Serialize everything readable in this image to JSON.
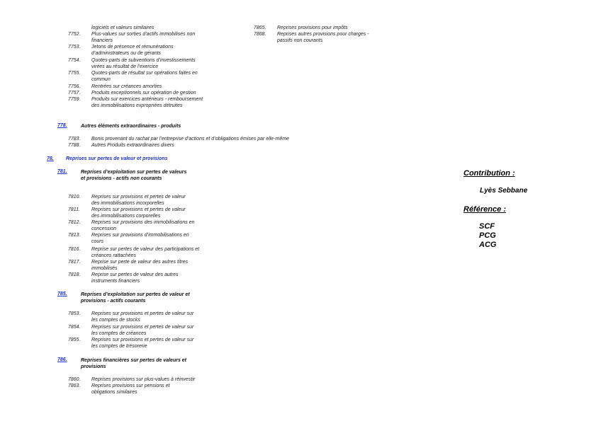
{
  "left_top_items": [
    {
      "code": "",
      "text": "logiciels et valeurs similaires"
    },
    {
      "code": "7752.",
      "text": "Plus-values sur sorties d’actifs immobilisés non financiers"
    },
    {
      "code": "7753.",
      "text": "Jetons de présence et rémunérations d’administrateurs ou de gérants"
    },
    {
      "code": "7754.",
      "text": "Quotes-parts de subventions d’investissements virées au résultat de l’exercice"
    },
    {
      "code": "7755.",
      "text": "Quotes-parts de résultat sur opérations faites en commun"
    },
    {
      "code": "7756.",
      "text": "Rentrées sur créances amorties"
    },
    {
      "code": "7757.",
      "text": "Produits exceptionnels sur opération de gestion"
    },
    {
      "code": "7759.",
      "text": "Produits sur exercices antérieurs - remboursement des immobilisations expropriées détruites"
    }
  ],
  "right_top_items": [
    {
      "code": "7865.",
      "text": "Reprises provisions pour impôts"
    },
    {
      "code": "7868.",
      "text": "Reprises autres provisions pour charges - passifs non courants"
    }
  ],
  "s778": {
    "code": "778.",
    "title": "Autres éléments extraordinaires - produits"
  },
  "s778_items": [
    {
      "code": "7783.",
      "text": "Bonis provenant du rachat par l’entreprise d’actions et d’obligations émises par elle-même"
    },
    {
      "code": "7788.",
      "text": "Autres Produits extraordinaires divers"
    }
  ],
  "s78": {
    "code": "78.",
    "title": "Reprises sur pertes de valeur et provisions"
  },
  "s781": {
    "code": "781.",
    "title": "Reprises d’exploitation sur pertes de valeurs et provisions - actifs non courants"
  },
  "s781_items": [
    {
      "code": "7810.",
      "text": "Reprises sur provisions et pertes de valeur des immobilisations incorporelles"
    },
    {
      "code": "7811.",
      "text": "Reprises sur provisions et pertes de valeur des immobilisations corporelles"
    },
    {
      "code": "7812.",
      "text": "Reprises sur provisions des immobilisations en concession"
    },
    {
      "code": "7813.",
      "text": "Reprises sur provisions d’immobilisations en cours"
    },
    {
      "code": "7816.",
      "text": "Reprise sur pertes de valeur des participations et créances rattachées"
    },
    {
      "code": "7817.",
      "text": "Reprise sur perte de valeur des autres titres immobilisés"
    },
    {
      "code": "7818.",
      "text": "Reprise sur pertes de valeur des autres instruments financiers"
    }
  ],
  "s785": {
    "code": "785.",
    "title": "Reprises d’exploitation sur pertes de valeur et provisions - actifs courants"
  },
  "s785_items": [
    {
      "code": "7853.",
      "text": "Reprises sur provisions et pertes de valeur sur les comptes de stocks"
    },
    {
      "code": "7854.",
      "text": "Reprises sur provisions et pertes de valeur sur les comptes de créances"
    },
    {
      "code": "7855.",
      "text": "Reprises sur provisions et pertes de valeur sur les comptes de trésorerie"
    }
  ],
  "s786": {
    "code": "786.",
    "title": "Reprises financières sur pertes de valeurs et provisions"
  },
  "s786_items": [
    {
      "code": "7860.",
      "text": "Reprises provisions sur plus-values à réinvestir"
    },
    {
      "code": "7863.",
      "text": "Reprises provisions sur pensions et obligations similaires"
    }
  ],
  "sidebar": {
    "contribution_heading": "Contribution :",
    "contributor": "Lyès Sebbane",
    "reference_heading": "Référence :",
    "references": [
      "SCF",
      "PCG",
      "ACG"
    ]
  },
  "colors": {
    "link_blue": "#1d2fd0"
  }
}
